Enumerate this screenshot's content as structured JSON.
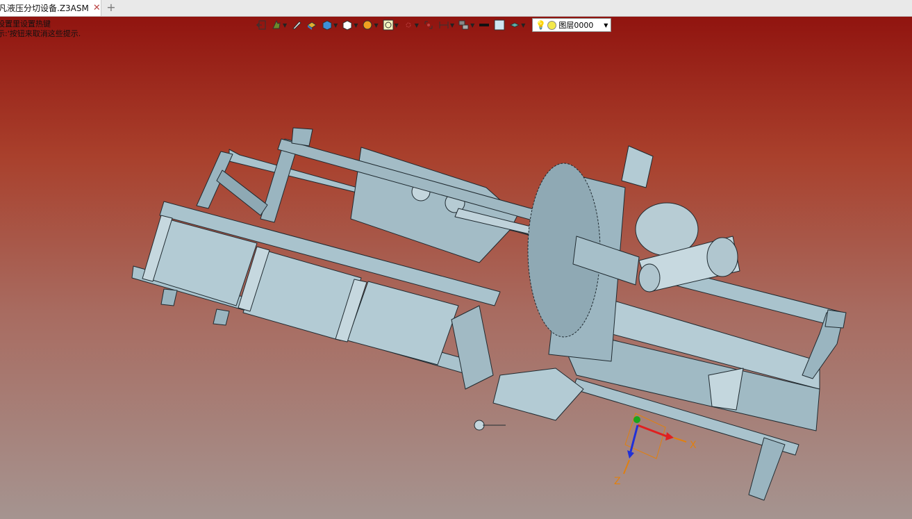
{
  "tab": {
    "title": "凡液压分切设备.Z3ASM",
    "close_glyph": "✕",
    "new_glyph": "+"
  },
  "hint": {
    "line1": "设置里设置热键",
    "line2": "示:'按钮来取消这些提示."
  },
  "toolbar": {
    "icons": [
      "exit-icon",
      "sketch-icon",
      "pen-icon",
      "shape-icon",
      "box-icon",
      "view-cube-icon",
      "render-icon",
      "zoom-icon",
      "pick-icon",
      "section-icon",
      "dimension-icon",
      "assembly-icon",
      "line-color-icon",
      "face-color-icon",
      "layer-material-icon"
    ],
    "layer_value": "图层0000"
  },
  "triad": {
    "x_label": "X",
    "z_label": "Z"
  },
  "colors": {
    "model": "#a9c3cd",
    "model_dark": "#7f9aa5",
    "edge": "#1f2a30",
    "triad_x": "#e02020",
    "triad_y": "#1aa61a",
    "triad_z": "#2030d8",
    "triad_label": "#e08010"
  }
}
